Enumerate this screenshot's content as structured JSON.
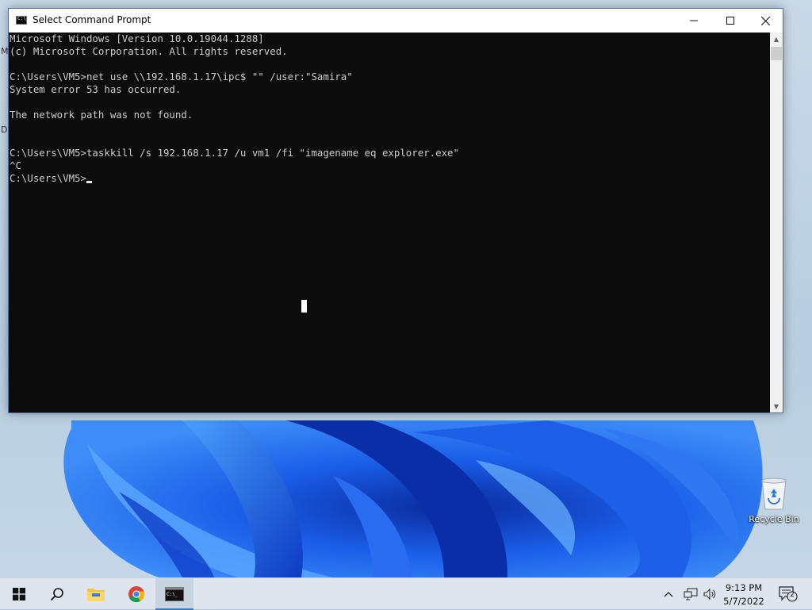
{
  "window": {
    "title": "Select Command Prompt",
    "minimize_icon": "minimize-icon",
    "maximize_icon": "maximize-icon",
    "close_icon": "close-icon"
  },
  "console": {
    "lines": [
      "Microsoft Windows [Version 10.0.19044.1288]",
      "(c) Microsoft Corporation. All rights reserved.",
      "",
      "C:\\Users\\VM5>net use \\\\192.168.1.17\\ipc$ \"\" /user:\"Samira\"",
      "System error 53 has occurred.",
      "",
      "The network path was not found.",
      "",
      "",
      "C:\\Users\\VM5>taskkill /s 192.168.1.17 /u vm1 /fi \"imagename eq explorer.exe\"",
      "^C",
      "C:\\Users\\VM5>"
    ]
  },
  "desktop": {
    "edge_glyphs": [
      "M",
      "D"
    ],
    "recycle_bin_label": "Recycle Bin"
  },
  "taskbar": {
    "items": [
      "start-icon",
      "search-icon",
      "file-explorer-icon",
      "chrome-icon",
      "command-prompt-icon"
    ],
    "clock_time": "9:13 PM",
    "clock_date": "5/7/2022",
    "notification_count": "2"
  },
  "colors": {
    "console_bg": "#0c0c0c",
    "console_text": "#cccccc",
    "titlebar_bg": "#ffffff",
    "taskbar_bg": "#dde6ee",
    "accent": "#3c78c8"
  }
}
